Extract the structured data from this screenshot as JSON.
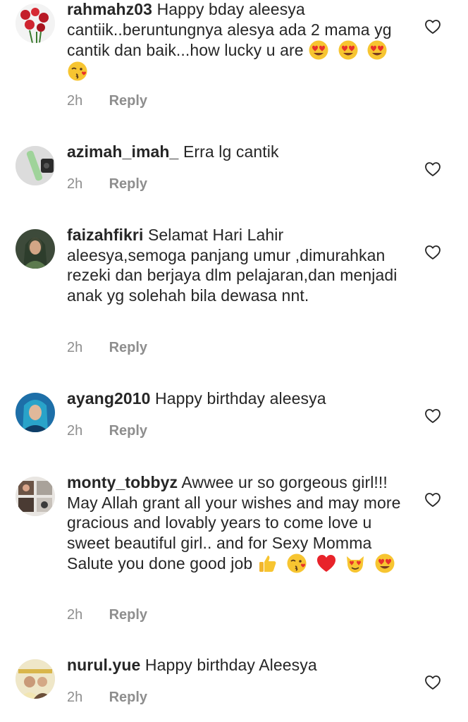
{
  "comments": [
    {
      "username": "rahmahz03",
      "text": "Happy bday aleesya cantiik..beruntungnya alesya ada 2 mama yg cantik dan baik...how lucky u are",
      "time": "2h",
      "reply_label": "Reply",
      "emojis": [
        "heart-eyes-emoji",
        "heart-eyes-emoji",
        "heart-eyes-emoji",
        "kissing-face-emoji"
      ]
    },
    {
      "username": "azimah_imah_",
      "text": "Erra lg cantik",
      "time": "2h",
      "reply_label": "Reply",
      "emojis": []
    },
    {
      "username": "faizahfikri",
      "text": "Selamat Hari Lahir aleesya,semoga panjang umur ,dimurahkan rezeki dan  berjaya dlm pelajaran,dan menjadi anak yg solehah bila dewasa nnt.",
      "time": "2h",
      "reply_label": "Reply",
      "emojis": []
    },
    {
      "username": "ayang2010",
      "text": "Happy birthday aleesya",
      "time": "2h",
      "reply_label": "Reply",
      "emojis": []
    },
    {
      "username": "monty_tobbyz",
      "text": "Awwee ur so gorgeous girl!!! May Allah grant all your wishes and may more gracious and lovably years to come love u sweet beautiful girl.. and for Sexy Momma Salute you done good job",
      "time": "2h",
      "reply_label": "Reply",
      "emojis": [
        "thumbs-up-emoji",
        "kissing-face-emoji",
        "red-heart-emoji",
        "heart-eyes-cat-emoji",
        "heart-eyes-emoji"
      ]
    },
    {
      "username": "nurul.yue",
      "text": "Happy birthday Aleesya",
      "time": "2h",
      "reply_label": "Reply",
      "emojis": []
    }
  ],
  "icons": {
    "like": "heart-outline-icon"
  },
  "colors": {
    "text": "#262626",
    "meta": "#8e8e8e",
    "background": "#ffffff"
  }
}
